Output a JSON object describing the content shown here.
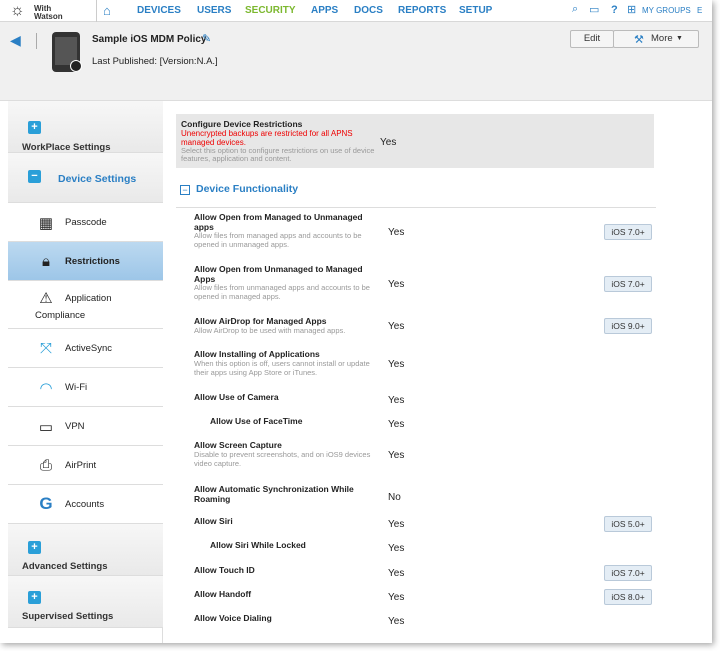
{
  "logo": {
    "line1": "With",
    "line2": "Watson"
  },
  "nav": {
    "items": [
      "DEVICES",
      "USERS",
      "SECURITY",
      "APPS",
      "DOCS",
      "REPORTS",
      "SETUP"
    ],
    "my_groups": "MY GROUPS",
    "help": "?",
    "trailing": "E"
  },
  "header": {
    "title": "Sample iOS MDM Policy",
    "last_published_label": "Last Published:",
    "last_published_value": "[Version:N.A.]",
    "edit": "Edit",
    "more": "More"
  },
  "sidebar": {
    "workplace": "WorkPlace Settings",
    "device_settings": "Device Settings",
    "items": [
      {
        "label": "Passcode",
        "icon": "keypad-icon"
      },
      {
        "label": "Restrictions",
        "icon": "lock-icon",
        "active": true
      },
      {
        "label": "Application",
        "label2": "Compliance",
        "icon": "app-compliance-icon"
      },
      {
        "label": "ActiveSync",
        "icon": "activesync-icon"
      },
      {
        "label": "Wi-Fi",
        "icon": "wifi-icon"
      },
      {
        "label": "VPN",
        "icon": "vpn-icon"
      },
      {
        "label": "AirPrint",
        "icon": "printer-icon"
      },
      {
        "label": "Accounts",
        "icon": "google-icon"
      }
    ],
    "advanced": "Advanced Settings",
    "supervised": "Supervised Settings"
  },
  "config": {
    "title": "Configure Device Restrictions",
    "warning": "Unencrypted backups are restricted for all APNS managed devices.",
    "desc": "Select this option to configure restrictions on use of device features, application and content.",
    "value": "Yes"
  },
  "section": {
    "title": "Device Functionality",
    "toggle": "−"
  },
  "rows": [
    {
      "title": "Allow Open from Managed to Unmanaged apps",
      "desc": "Allow files from managed apps and accounts to be opened in unmanaged apps.",
      "value": "Yes",
      "badge": "iOS 7.0+"
    },
    {
      "title": "Allow Open from Unmanaged to Managed Apps",
      "desc": "Allow files from unmanaged apps and accounts to be opened in managed apps.",
      "value": "Yes",
      "badge": "iOS 7.0+"
    },
    {
      "title": "Allow AirDrop for Managed Apps",
      "desc": "Allow AirDrop to be used with managed apps.",
      "value": "Yes",
      "badge": "iOS 9.0+"
    },
    {
      "title": "Allow Installing of Applications",
      "desc": "When this option is off, users cannot install or update their apps using App Store or iTunes.",
      "value": "Yes",
      "badge": ""
    },
    {
      "title": "Allow Use of Camera",
      "desc": "",
      "value": "Yes",
      "badge": ""
    },
    {
      "title": "Allow Use of FaceTime",
      "desc": "",
      "value": "Yes",
      "badge": "",
      "sub": true
    },
    {
      "title": "Allow Screen Capture",
      "desc": "Disable to prevent screenshots, and on iOS9 devices video capture.",
      "value": "Yes",
      "badge": ""
    },
    {
      "title": "Allow Automatic Synchronization While Roaming",
      "desc": "",
      "value": "No",
      "badge": ""
    },
    {
      "title": "Allow Siri",
      "desc": "",
      "value": "Yes",
      "badge": "iOS 5.0+"
    },
    {
      "title": "Allow Siri While Locked",
      "desc": "",
      "value": "Yes",
      "badge": "",
      "sub": true
    },
    {
      "title": "Allow Touch ID",
      "desc": "",
      "value": "Yes",
      "badge": "iOS 7.0+"
    },
    {
      "title": "Allow Handoff",
      "desc": "",
      "value": "Yes",
      "badge": "iOS 8.0+"
    },
    {
      "title": "Allow Voice Dialing",
      "desc": "",
      "value": "Yes",
      "badge": ""
    }
  ]
}
